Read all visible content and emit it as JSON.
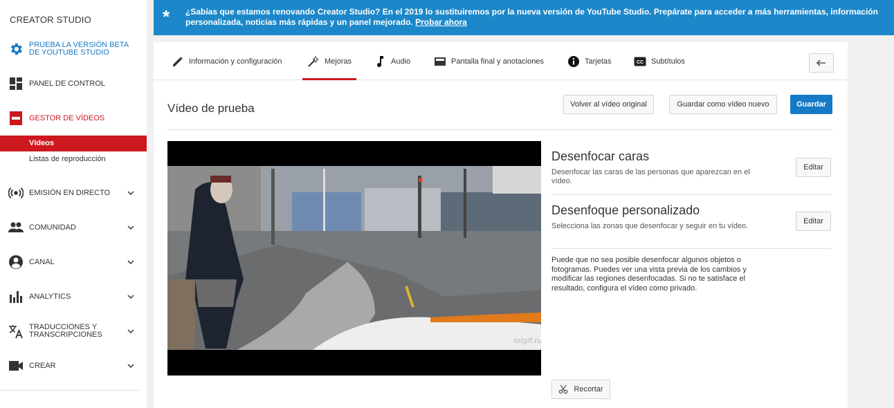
{
  "sidebar": {
    "brand": "CREATOR STUDIO",
    "items": [
      {
        "label": "PRUEBA LA VERSIÓN BETA DE YOUTUBE STUDIO",
        "icon": "gear-icon",
        "color": "#167ac6"
      },
      {
        "label": "PANEL DE CONTROL",
        "icon": "dashboard-icon"
      },
      {
        "label": "GESTOR DE VÍDEOS",
        "icon": "video-manager-icon",
        "color": "#cc181e"
      },
      {
        "label": "EMISIÓN EN DIRECTO",
        "icon": "live-icon"
      },
      {
        "label": "COMUNIDAD",
        "icon": "community-icon"
      },
      {
        "label": "CANAL",
        "icon": "account-icon"
      },
      {
        "label": "ANALYTICS",
        "icon": "bar-chart-icon"
      },
      {
        "label": "TRADUCCIONES Y TRANSCRIPCIONES",
        "icon": "translate-icon"
      },
      {
        "label": "CREAR",
        "icon": "camera-icon"
      }
    ],
    "subitems": [
      {
        "label": "Vídeos",
        "active": true
      },
      {
        "label": "Listas de reproducción",
        "active": false
      }
    ]
  },
  "banner": {
    "text": "¿Sabías que estamos renovando Creator Studio? En el 2019 lo sustituiremos por la nueva versión de YouTube Studio. Prepárate para acceder a más herramientas, información personalizada, noticias más rápidas y un panel mejorado.",
    "link": "Probar ahora",
    "color": "#1c87c9"
  },
  "tabs": [
    {
      "label": "Información y configuración",
      "icon": "pencil-icon"
    },
    {
      "label": "Mejoras",
      "icon": "magic-wand-icon",
      "active": true
    },
    {
      "label": "Audio",
      "icon": "music-note-icon"
    },
    {
      "label": "Pantalla final y anotaciones",
      "icon": "end-screen-icon"
    },
    {
      "label": "Tarjetas",
      "icon": "info-icon"
    },
    {
      "label": "Subtítulos",
      "icon": "cc-icon"
    }
  ],
  "main": {
    "title": "Vídeo de prueba",
    "buttons": {
      "revert": "Volver al vídeo original",
      "save_new": "Guardar como vídeo nuevo",
      "save": "Guardar"
    },
    "watermark": "lolgif.ru",
    "blur_faces": {
      "title": "Desenfocar caras",
      "desc": "Desenfocar las caras de las personas que aparezcan en el vídeo.",
      "button": "Editar"
    },
    "custom_blur": {
      "title": "Desenfoque personalizado",
      "desc": "Selecciona las zonas que desenfocar y seguir en tu vídeo.",
      "button": "Editar"
    },
    "note": "Puede que no sea posible desenfocar algunos objetos o fotogramas. Puedes ver una vista previa de los cambios y modificar las regiones desenfocadas. Si no te satisface el resultado, configura el vídeo como privado.",
    "trim_button": "Recortar"
  },
  "colors": {
    "accent_red": "#cc181e",
    "accent_blue": "#167ac6"
  }
}
